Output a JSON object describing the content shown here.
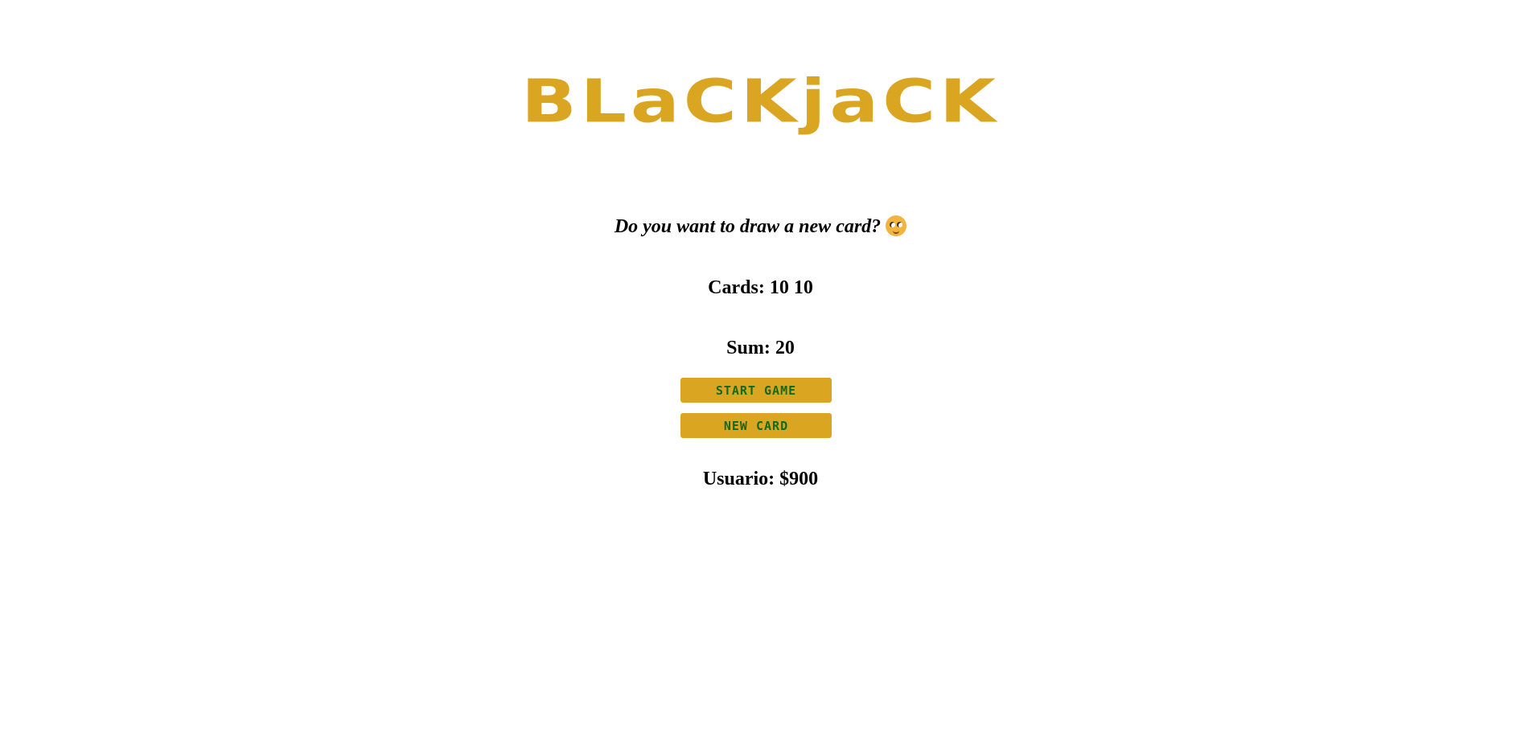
{
  "game": {
    "title": "BLaCKjaCK",
    "message": "Do you want to draw a new card?",
    "message_emoji": "smiling-face-emoji",
    "cards_text": "Cards: 10 10",
    "sum_text": "Sum: 20",
    "player_text": "Usuario: $900"
  },
  "buttons": {
    "start_label": "START GAME",
    "new_card_label": "NEW CARD"
  },
  "colors": {
    "accent": "#daa520",
    "button_text": "#0f6b1f",
    "text": "#000000",
    "background": "#ffffff"
  }
}
